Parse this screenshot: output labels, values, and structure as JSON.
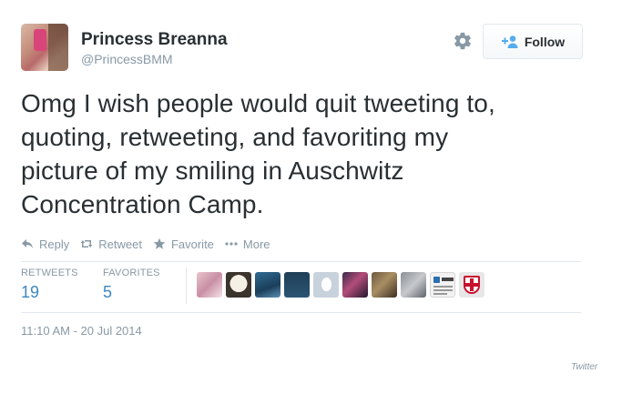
{
  "user": {
    "name": "Princess Breanna",
    "handle": "@PrincessBMM"
  },
  "follow_button": {
    "label": "Follow"
  },
  "tweet": {
    "lines": [
      "Omg I wish people would quit tweeting to,",
      "quoting, retweeting, and favoriting my",
      "picture of my smiling in Auschwitz",
      "Concentration Camp."
    ]
  },
  "actions": [
    {
      "label": "Reply",
      "icon": "reply-icon"
    },
    {
      "label": "Retweet",
      "icon": "retweet-icon"
    },
    {
      "label": "Favorite",
      "icon": "star-icon"
    },
    {
      "label": "More",
      "icon": "more-icon"
    }
  ],
  "stats": {
    "retweets_label": "RETWEETS",
    "retweets_count": "19",
    "favorites_label": "FAVORITES",
    "favorites_count": "5"
  },
  "timestamp": "11:10 AM - 20 Jul 2014",
  "brand": "Twitter",
  "colors": {
    "accent": "#3b88c3",
    "muted": "#8899a6",
    "text": "#292f33",
    "border": "#e1e8ed"
  }
}
